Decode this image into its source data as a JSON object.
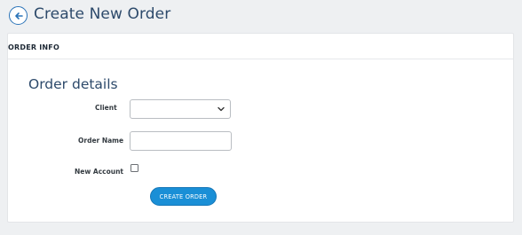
{
  "header": {
    "title": "Create New Order",
    "back_icon": "arrow-left-circle-icon"
  },
  "card": {
    "header_label": "ORDER INFO",
    "section_title": "Order details"
  },
  "form": {
    "client_label": "Client",
    "client_value": "",
    "order_name_label": "Order Name",
    "order_name_value": "",
    "new_account_label": "New Account",
    "new_account_checked": false,
    "submit_label": "CREATE ORDER"
  },
  "colors": {
    "accent": "#1a8fd6",
    "title_text": "#2d4a6b",
    "background": "#eef0f2"
  }
}
